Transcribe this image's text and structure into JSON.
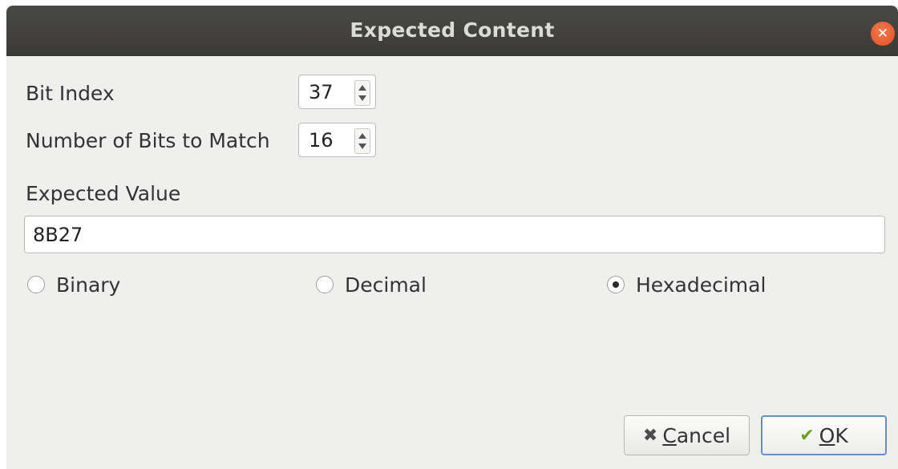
{
  "window": {
    "title": "Expected Content",
    "close_icon": "close-icon"
  },
  "fields": {
    "bit_index_label": "Bit Index",
    "bit_index_value": "37",
    "num_bits_label": "Number of Bits to Match",
    "num_bits_value": "16",
    "expected_value_label": "Expected Value",
    "expected_value": "8B27"
  },
  "format": {
    "options": [
      {
        "label": "Binary",
        "selected": false
      },
      {
        "label": "Decimal",
        "selected": false
      },
      {
        "label": "Hexadecimal",
        "selected": true
      }
    ]
  },
  "buttons": {
    "cancel_label": "Cancel",
    "cancel_icon": "x-icon",
    "ok_label": "OK",
    "ok_icon": "checkmark-icon"
  },
  "colors": {
    "titlebar": "#3f3e3a",
    "close_button": "#e95420",
    "default_button_border": "#5e8fd0",
    "ok_check": "#6aa226"
  }
}
